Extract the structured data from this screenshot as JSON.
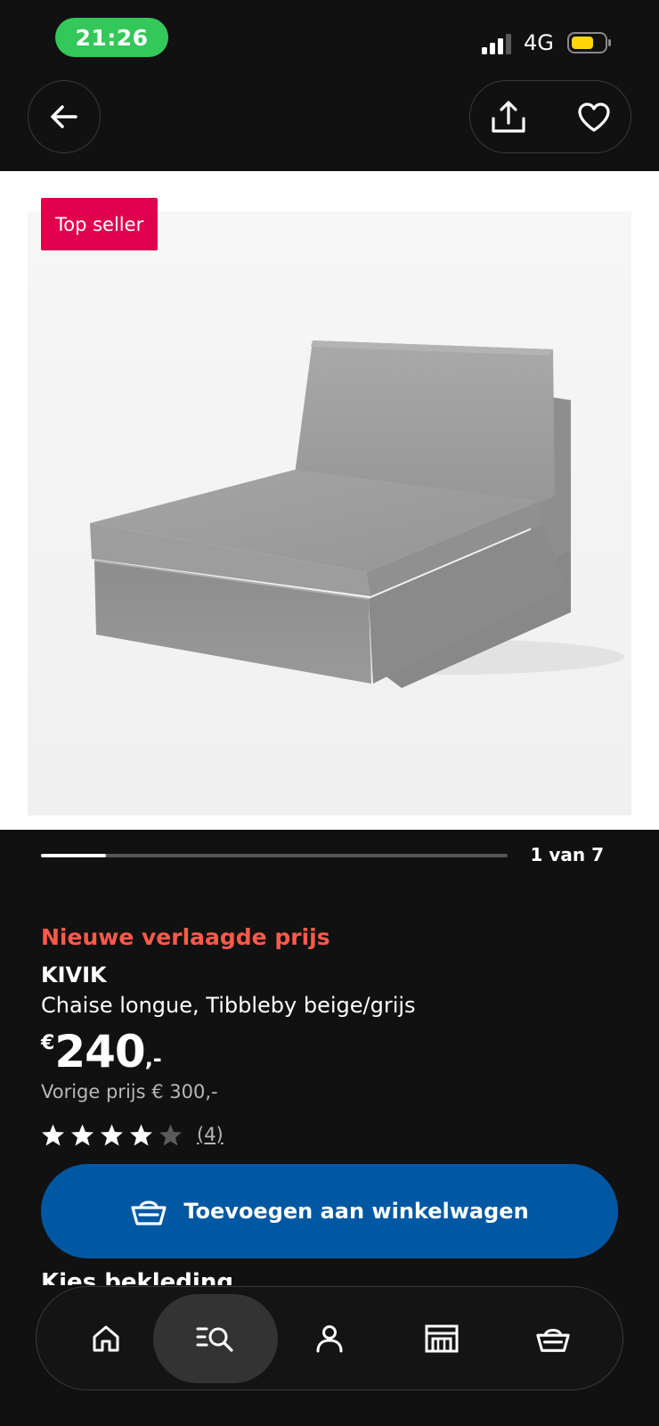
{
  "status_bar": {
    "time": "21:26",
    "network": "4G",
    "battery_color": "#ffd60a",
    "time_pill_color": "#34c759"
  },
  "top_nav": {
    "back_icon": "arrow-left-icon",
    "share_icon": "share-icon",
    "favorite_icon": "heart-icon"
  },
  "product_image": {
    "badge": "Top seller",
    "badge_color": "#e0004d"
  },
  "carousel": {
    "current": 1,
    "total": 7,
    "label": "1 van 7",
    "progress": 0.14
  },
  "product": {
    "promo": "Nieuwe verlaagde prijs",
    "name": "KIVIK",
    "description": "Chaise longue, Tibbleby beige/grijs",
    "price_currency": "€",
    "price_integer": "240",
    "price_decimal": ",-",
    "previous_price": "Vorige prijs € 300,-",
    "rating": 4,
    "rating_max": 5,
    "review_count": "(4)",
    "promo_color": "#ff5a4a"
  },
  "cart_button": {
    "label": "Toevoegen aan winkelwagen",
    "color": "#0058a3",
    "icon": "basket-icon"
  },
  "next_section": {
    "heading": "Kies bekleding"
  },
  "bottom_nav": {
    "items": [
      {
        "name": "home",
        "icon": "home-icon",
        "active": false
      },
      {
        "name": "search",
        "icon": "search-icon",
        "active": true
      },
      {
        "name": "profile",
        "icon": "user-icon",
        "active": false
      },
      {
        "name": "store",
        "icon": "store-icon",
        "active": false
      },
      {
        "name": "cart",
        "icon": "basket-icon",
        "active": false
      }
    ]
  }
}
